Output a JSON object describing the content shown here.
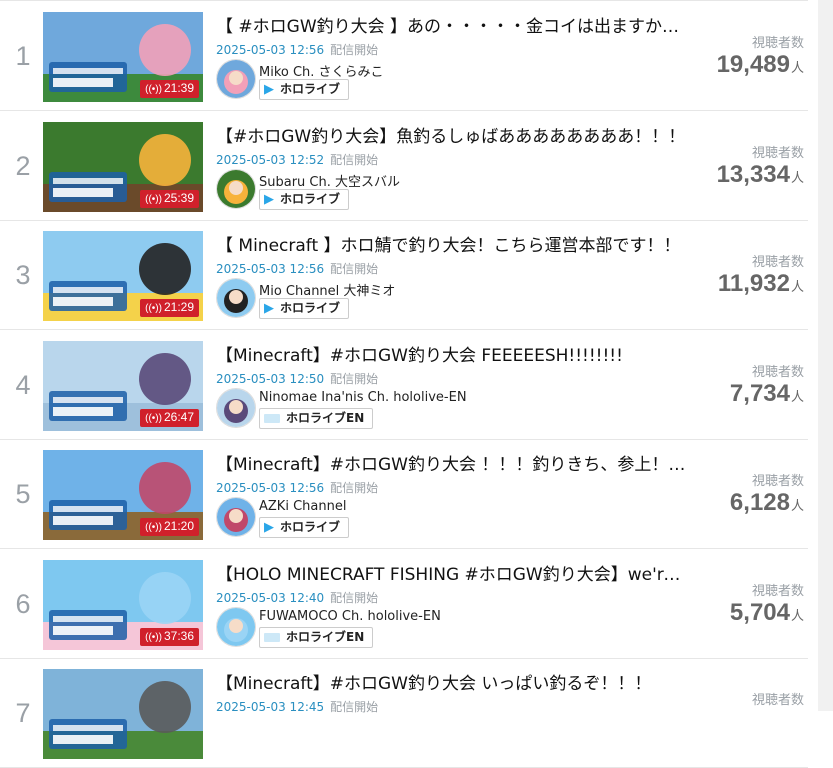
{
  "viewers_label": "視聴者数",
  "viewers_unit": "人",
  "start_label": "配信開始",
  "streams": [
    {
      "rank": "1",
      "title": "【 #ホロGW釣り大会 】あの・・・・・金コイは出ますか・・？",
      "date": "2025-05-03 12:56",
      "channel": "Miko Ch. さくらみこ",
      "affiliation": "ホロライブ",
      "duration": "21:39",
      "viewers": "19,489",
      "colors": [
        "#6fa8dc",
        "#3d8a3d",
        "#f2a0b8"
      ]
    },
    {
      "rank": "2",
      "title": "【#ホロGW釣り大会】魚釣るしゅばああああああああ！！！",
      "date": "2025-05-03 12:52",
      "channel": "Subaru Ch. 大空スバル",
      "affiliation": "ホロライブ",
      "duration": "25:39",
      "viewers": "13,334",
      "colors": [
        "#3b7a2e",
        "#6a4a2a",
        "#f7b23b"
      ]
    },
    {
      "rank": "3",
      "title": "【 Minecraft 】ホロ鯖で釣り大会！こちら運営本部です！！",
      "date": "2025-05-03 12:56",
      "channel": "Mio Channel 大神ミオ",
      "affiliation": "ホロライブ",
      "duration": "21:29",
      "viewers": "11,932",
      "colors": [
        "#8ecbf0",
        "#f4d24a",
        "#222222"
      ]
    },
    {
      "rank": "4",
      "title": "【Minecraft】#ホロGW釣り大会 FEEEEESH!!!!!!!!",
      "date": "2025-05-03 12:50",
      "channel": "Ninomae Ina'nis Ch. hololive-EN",
      "affiliation": "ホロライブEN",
      "duration": "26:47",
      "viewers": "7,734",
      "colors": [
        "#b9d6ec",
        "#9ec0dc",
        "#5a4a7a"
      ]
    },
    {
      "rank": "5",
      "title": "【Minecraft】#ホロGW釣り大会 ！！！釣りきち、参上！！！",
      "date": "2025-05-03 12:56",
      "channel": "AZKi Channel",
      "affiliation": "ホロライブ",
      "duration": "21:20",
      "viewers": "6,128",
      "colors": [
        "#6fb2e8",
        "#8a6a3a",
        "#c0486a"
      ]
    },
    {
      "rank": "6",
      "title": "【HOLO MINECRAFT FISHING #ホロGW釣り大会】we're gonna fish!!",
      "date": "2025-05-03 12:40",
      "channel": "FUWAMOCO Ch. hololive-EN",
      "affiliation": "ホロライブEN",
      "duration": "37:36",
      "viewers": "5,704",
      "colors": [
        "#7ec8f0",
        "#f5c6d8",
        "#9ad4f5"
      ]
    },
    {
      "rank": "7",
      "title": "【Minecraft】#ホロGW釣り大会 いっぱい釣るぞ！！！",
      "date": "2025-05-03 12:45",
      "channel": "",
      "affiliation": "",
      "duration": "",
      "viewers": "",
      "colors": [
        "#7fb3d9",
        "#4a8a3a",
        "#5a5a5a"
      ]
    }
  ]
}
